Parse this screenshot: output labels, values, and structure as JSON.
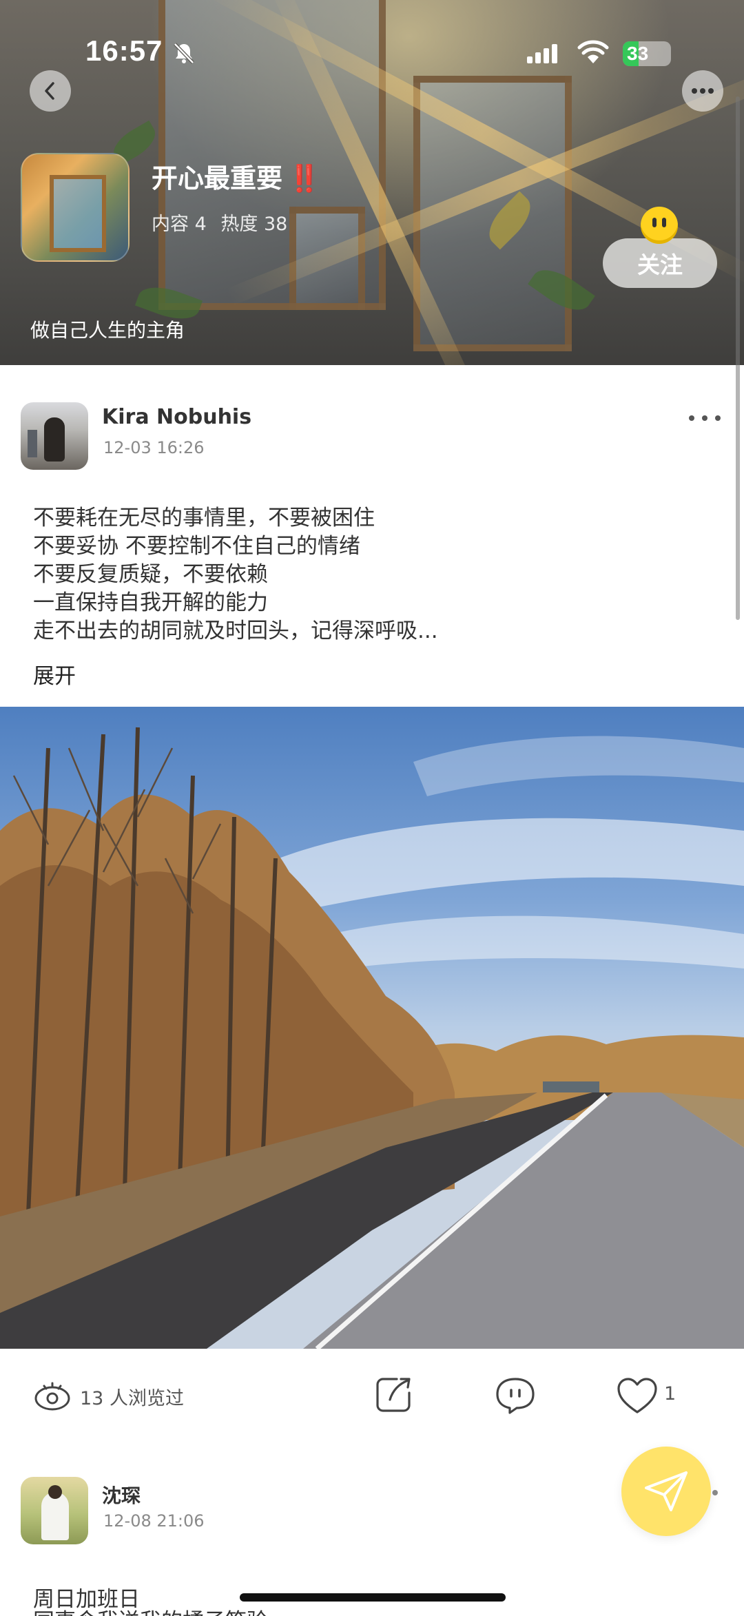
{
  "status_bar": {
    "time": "16:57",
    "battery_level": "33",
    "battery_fraction": 0.33,
    "icons": [
      "bell-slash-icon",
      "cellular-signal-icon",
      "wifi-icon",
      "battery-charging-icon"
    ]
  },
  "header": {
    "group_title": "开心最重要",
    "title_emoji": "‼️",
    "content_label": "内容",
    "content_count": "4",
    "heat_label": "热度",
    "heat_count": "38",
    "description": "做自己人生的主角",
    "follow_label": "关注"
  },
  "post": {
    "author": "Kira Nobuhis",
    "time": "12-03 16:26",
    "lines": [
      "不要耗在无尽的事情里，不要被困住",
      "不要妥协 不要控制不住自己的情绪",
      "不要反复质疑，不要依赖",
      "一直保持自我开解的能力",
      "走不出去的胡同就及时回头，记得深呼吸..."
    ],
    "expand_label": "展开",
    "views_text": "13 人浏览过",
    "like_count": "1"
  },
  "post2": {
    "author": "沈琛",
    "time": "12-08 21:06",
    "first_line": "周日加班日",
    "second_line_partial": "同事令我送我的橘子箱验"
  },
  "colors": {
    "accent_yellow": "#ffe36a",
    "title_exclaim_red": "#e5262a",
    "battery_green": "#35c759"
  }
}
